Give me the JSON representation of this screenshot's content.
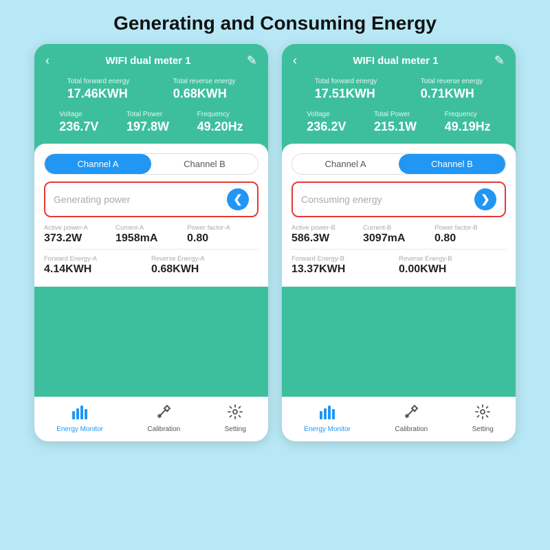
{
  "page": {
    "title": "Generating and Consuming Energy",
    "background": "#b8e8f5"
  },
  "phone_left": {
    "header": {
      "back_icon": "‹",
      "title": "WIFI dual meter 1",
      "edit_icon": "✎"
    },
    "energy": {
      "forward_label": "Total  forward energy",
      "forward_value": "17.46KWH",
      "reverse_label": "Total reverse energy",
      "reverse_value": "0.68KWH"
    },
    "power": {
      "voltage_label": "Voltage",
      "voltage_value": "236.7V",
      "total_power_label": "Total Power",
      "total_power_value": "197.8W",
      "frequency_label": "Frequency",
      "frequency_value": "49.20Hz"
    },
    "tabs": {
      "channel_a": "Channel A",
      "channel_b": "Channel B",
      "active": "A"
    },
    "mode": {
      "label": "Generating power",
      "icon": "❮"
    },
    "details": {
      "active_power_label": "Active power-A",
      "active_power_value": "373.2W",
      "current_label": "Current-A",
      "current_value": "1958mA",
      "power_factor_label": "Power factor-A",
      "power_factor_value": "0.80",
      "forward_energy_label": "Forward Energy-A",
      "forward_energy_value": "4.14KWH",
      "reverse_energy_label": "Reverse Energy-A",
      "reverse_energy_value": "0.68KWH"
    },
    "footer": {
      "items": [
        {
          "label": "Energy Monitor",
          "icon": "📊",
          "active": true
        },
        {
          "label": "Calibration",
          "icon": "🔧",
          "active": false
        },
        {
          "label": "Setting",
          "icon": "⚙",
          "active": false
        }
      ]
    }
  },
  "phone_right": {
    "header": {
      "back_icon": "‹",
      "title": "WIFI dual meter 1",
      "edit_icon": "✎"
    },
    "energy": {
      "forward_label": "Total  forward energy",
      "forward_value": "17.51KWH",
      "reverse_label": "Total reverse energy",
      "reverse_value": "0.71KWH"
    },
    "power": {
      "voltage_label": "Voltage",
      "voltage_value": "236.2V",
      "total_power_label": "Total Power",
      "total_power_value": "215.1W",
      "frequency_label": "Frequency",
      "frequency_value": "49.19Hz"
    },
    "tabs": {
      "channel_a": "Channel A",
      "channel_b": "Channel B",
      "active": "B"
    },
    "mode": {
      "label": "Consuming energy",
      "icon": "❯"
    },
    "details": {
      "active_power_label": "Active power-B",
      "active_power_value": "586.3W",
      "current_label": "Current-B",
      "current_value": "3097mA",
      "power_factor_label": "Power factor-B",
      "power_factor_value": "0.80",
      "forward_energy_label": "Forward Energy-B",
      "forward_energy_value": "13.37KWH",
      "reverse_energy_label": "Reverse Energy-B",
      "reverse_energy_value": "0.00KWH"
    },
    "footer": {
      "items": [
        {
          "label": "Energy Monitor",
          "icon": "📊",
          "active": true
        },
        {
          "label": "Calibration",
          "icon": "🔧",
          "active": false
        },
        {
          "label": "Setting",
          "icon": "⚙",
          "active": false
        }
      ]
    }
  }
}
